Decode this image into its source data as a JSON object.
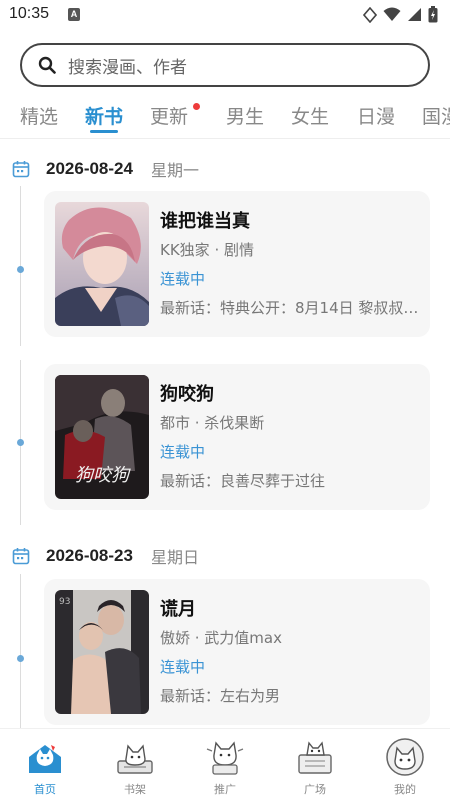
{
  "status_bar": {
    "time": "10:35",
    "notification_letter": "A"
  },
  "search": {
    "placeholder": "搜索漫画、作者"
  },
  "tabs": [
    {
      "label": "精选",
      "active": false
    },
    {
      "label": "新书",
      "active": true
    },
    {
      "label": "更新",
      "active": false,
      "has_badge_dot": true
    },
    {
      "label": "男生",
      "active": false
    },
    {
      "label": "女生",
      "active": false
    },
    {
      "label": "日漫",
      "active": false
    },
    {
      "label": "国漫",
      "active": false
    }
  ],
  "feed": [
    {
      "date": "2026-08-24",
      "weekday": "星期一",
      "items": [
        {
          "title": "谁把谁当真",
          "tags": "KK独家 · 剧情",
          "status": "连载中",
          "latest": "最新话：特典公开：8月14日 黎叔叔…"
        },
        {
          "title": "狗咬狗",
          "tags": "都市 · 杀伐果断",
          "status": "连载中",
          "latest": "最新话：良善尽葬于过往"
        }
      ]
    },
    {
      "date": "2026-08-23",
      "weekday": "星期日",
      "items": [
        {
          "title": "谎月",
          "tags": "傲娇 · 武力值max",
          "status": "连载中",
          "latest": "最新话：左右为男"
        }
      ]
    }
  ],
  "bottom_nav": [
    {
      "label": "首页",
      "icon": "home-cat-icon",
      "active": true
    },
    {
      "label": "书架",
      "icon": "bookshelf-cat-icon",
      "active": false
    },
    {
      "label": "推广",
      "icon": "promote-cat-icon",
      "active": false
    },
    {
      "label": "广场",
      "icon": "plaza-cat-icon",
      "active": false
    },
    {
      "label": "我的",
      "icon": "profile-avatar-icon",
      "active": false
    }
  ],
  "colors": {
    "accent": "#2a8fd0",
    "badge": "#ee3b3b",
    "card_bg": "#f6f6f6"
  }
}
